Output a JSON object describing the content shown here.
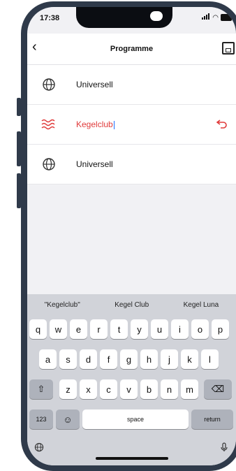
{
  "status": {
    "time": "17:38"
  },
  "nav": {
    "title": "Programme"
  },
  "list": [
    {
      "label": "Universell",
      "icon": "globe-icon",
      "active": false
    },
    {
      "label": "Kegelclub",
      "icon": "wave-icon",
      "active": true
    },
    {
      "label": "Universell",
      "icon": "globe-icon",
      "active": false
    }
  ],
  "keyboard": {
    "suggestions": [
      "\"Kegelclub\"",
      "Kegel Club",
      "Kegel Luna"
    ],
    "row1": [
      "q",
      "w",
      "e",
      "r",
      "t",
      "y",
      "u",
      "i",
      "o",
      "p"
    ],
    "row2": [
      "a",
      "s",
      "d",
      "f",
      "g",
      "h",
      "j",
      "k",
      "l"
    ],
    "row3": [
      "z",
      "x",
      "c",
      "v",
      "b",
      "n",
      "m"
    ],
    "numbers_label": "123",
    "space_label": "space",
    "return_label": "return"
  },
  "colors": {
    "accent": "#e03a3a",
    "frame": "#2f3a4a"
  }
}
